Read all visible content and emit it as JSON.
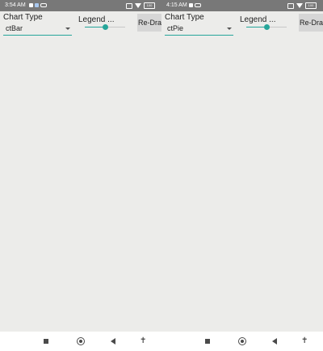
{
  "colors": {
    "accent": "#26a69a",
    "status_bar": "#787878",
    "background": "#ececea",
    "button_bg": "#d6d6d6"
  },
  "screens": [
    {
      "status": {
        "time": "3:54 AM",
        "battery": "100",
        "left_icons": [
          "video-icon",
          "notification-icon",
          "key-icon"
        ],
        "right_icons": [
          "sim-icon",
          "wifi-icon",
          "battery-icon"
        ]
      },
      "toolbar": {
        "chart_type_label": "Chart Type",
        "chart_type_value": "ctBar",
        "legend_label": "Legend ...",
        "legend_slider_level": 0.5,
        "redraw_label": "Re-Draw"
      },
      "nav": {
        "icons": [
          "recents-square-icon",
          "home-circle-icon",
          "back-triangle-icon",
          "accessibility-icon"
        ]
      }
    },
    {
      "status": {
        "time": "4:15 AM",
        "battery": "100",
        "left_icons": [
          "video-icon",
          "key-icon"
        ],
        "right_icons": [
          "sim-icon",
          "wifi-icon",
          "battery-icon"
        ]
      },
      "toolbar": {
        "chart_type_label": "Chart Type",
        "chart_type_value": "ctPie",
        "legend_label": "Legend ...",
        "legend_slider_level": 0.5,
        "redraw_label": "Re-Draw"
      },
      "nav": {
        "icons": [
          "recents-square-icon",
          "home-circle-icon",
          "back-triangle-icon",
          "accessibility-icon"
        ]
      }
    }
  ]
}
